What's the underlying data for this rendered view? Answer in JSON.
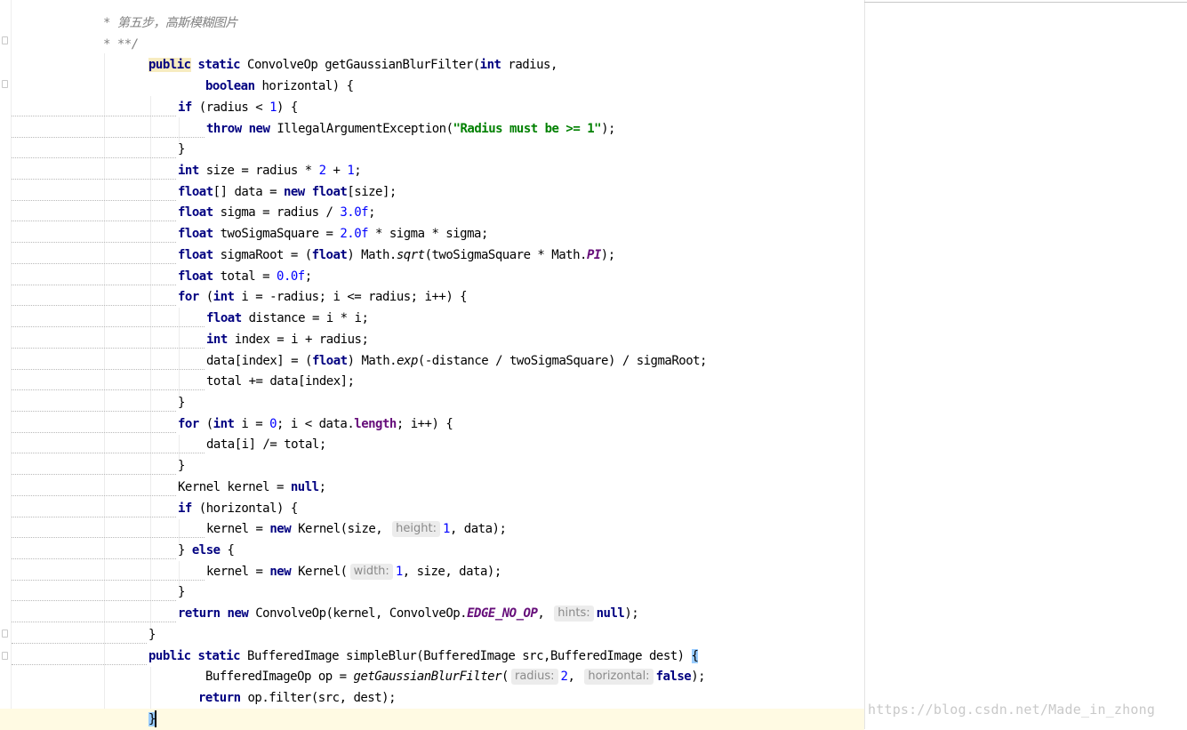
{
  "editor": {
    "lines": [
      {
        "indent": 116,
        "tokens": [
          {
            "t": "* ",
            "c": "doc"
          },
          {
            "t": "第五步，高斯模糊图片",
            "c": "doc"
          }
        ]
      },
      {
        "indent": 116,
        "tokens": [
          {
            "t": "* **/",
            "c": "doc"
          }
        ]
      },
      {
        "indent": 167,
        "tokens": [
          {
            "t": "public",
            "c": "kw hl-word"
          },
          {
            "t": " "
          },
          {
            "t": "static",
            "c": "kw"
          },
          {
            "t": " ConvolveOp getGaussianBlurFilter("
          },
          {
            "t": "int",
            "c": "kw"
          },
          {
            "t": " radius,"
          }
        ]
      },
      {
        "indent": 231,
        "tokens": [
          {
            "t": "boolean",
            "c": "kw"
          },
          {
            "t": " horizontal) {"
          }
        ]
      },
      {
        "indent": 200,
        "tokens": [
          {
            "t": "if",
            "c": "kw"
          },
          {
            "t": " (radius < "
          },
          {
            "t": "1",
            "c": "num"
          },
          {
            "t": ") {"
          }
        ]
      },
      {
        "indent": 232,
        "tokens": [
          {
            "t": "throw",
            "c": "kw"
          },
          {
            "t": " "
          },
          {
            "t": "new",
            "c": "kw"
          },
          {
            "t": " IllegalArgumentException("
          },
          {
            "t": "\"Radius must be >= 1\"",
            "c": "str"
          },
          {
            "t": ");"
          }
        ]
      },
      {
        "indent": 200,
        "tokens": [
          {
            "t": "}"
          }
        ]
      },
      {
        "indent": 200,
        "tokens": [
          {
            "t": "int",
            "c": "kw"
          },
          {
            "t": " size = radius * "
          },
          {
            "t": "2",
            "c": "num"
          },
          {
            "t": " + "
          },
          {
            "t": "1",
            "c": "num"
          },
          {
            "t": ";"
          }
        ]
      },
      {
        "indent": 200,
        "tokens": [
          {
            "t": "float",
            "c": "kw"
          },
          {
            "t": "[] data = "
          },
          {
            "t": "new",
            "c": "kw"
          },
          {
            "t": " "
          },
          {
            "t": "float",
            "c": "kw"
          },
          {
            "t": "[size];"
          }
        ]
      },
      {
        "indent": 200,
        "tokens": [
          {
            "t": "float",
            "c": "kw"
          },
          {
            "t": " sigma = radius / "
          },
          {
            "t": "3.0f",
            "c": "num"
          },
          {
            "t": ";"
          }
        ]
      },
      {
        "indent": 200,
        "tokens": [
          {
            "t": "float",
            "c": "kw"
          },
          {
            "t": " twoSigmaSquare = "
          },
          {
            "t": "2.0f",
            "c": "num"
          },
          {
            "t": " * sigma * sigma;"
          }
        ]
      },
      {
        "indent": 200,
        "tokens": [
          {
            "t": "float",
            "c": "kw"
          },
          {
            "t": " sigmaRoot = ("
          },
          {
            "t": "float",
            "c": "kw"
          },
          {
            "t": ") Math."
          },
          {
            "t": "sqrt",
            "c": "it"
          },
          {
            "t": "(twoSigmaSquare * Math."
          },
          {
            "t": "PI",
            "c": "sf"
          },
          {
            "t": ");"
          }
        ]
      },
      {
        "indent": 200,
        "tokens": [
          {
            "t": "float",
            "c": "kw"
          },
          {
            "t": " total = "
          },
          {
            "t": "0.0f",
            "c": "num"
          },
          {
            "t": ";"
          }
        ]
      },
      {
        "indent": 200,
        "tokens": [
          {
            "t": "for",
            "c": "kw"
          },
          {
            "t": " ("
          },
          {
            "t": "int",
            "c": "kw"
          },
          {
            "t": " i = -radius; i <= radius; i++) {"
          }
        ]
      },
      {
        "indent": 232,
        "tokens": [
          {
            "t": "float",
            "c": "kw"
          },
          {
            "t": " distance = i * i;"
          }
        ]
      },
      {
        "indent": 232,
        "tokens": [
          {
            "t": "int",
            "c": "kw"
          },
          {
            "t": " index = i + radius;"
          }
        ]
      },
      {
        "indent": 232,
        "tokens": [
          {
            "t": "data[index] = ("
          },
          {
            "t": "float",
            "c": "kw"
          },
          {
            "t": ") Math."
          },
          {
            "t": "exp",
            "c": "it"
          },
          {
            "t": "(-distance / twoSigmaSquare) / sigmaRoot;"
          }
        ]
      },
      {
        "indent": 232,
        "tokens": [
          {
            "t": "total += data[index];"
          }
        ]
      },
      {
        "indent": 200,
        "tokens": [
          {
            "t": "}"
          }
        ]
      },
      {
        "indent": 200,
        "tokens": [
          {
            "t": "for",
            "c": "kw"
          },
          {
            "t": " ("
          },
          {
            "t": "int",
            "c": "kw"
          },
          {
            "t": " i = "
          },
          {
            "t": "0",
            "c": "num"
          },
          {
            "t": "; i < data."
          },
          {
            "t": "length",
            "c": "fld"
          },
          {
            "t": "; i++) {"
          }
        ]
      },
      {
        "indent": 232,
        "tokens": [
          {
            "t": "data[i] /= total;"
          }
        ]
      },
      {
        "indent": 200,
        "tokens": [
          {
            "t": "}"
          }
        ]
      },
      {
        "indent": 200,
        "tokens": [
          {
            "t": "Kernel kernel = "
          },
          {
            "t": "null",
            "c": "kw"
          },
          {
            "t": ";"
          }
        ]
      },
      {
        "indent": 200,
        "tokens": [
          {
            "t": "if",
            "c": "kw"
          },
          {
            "t": " (horizontal) {"
          }
        ]
      },
      {
        "indent": 232,
        "tokens": [
          {
            "t": "kernel = "
          },
          {
            "t": "new",
            "c": "kw"
          },
          {
            "t": " Kernel(size, "
          },
          {
            "t": "height:",
            "c": "hint"
          },
          {
            "t": "1",
            "c": "num"
          },
          {
            "t": ", data);"
          }
        ]
      },
      {
        "indent": 200,
        "tokens": [
          {
            "t": "} "
          },
          {
            "t": "else",
            "c": "kw"
          },
          {
            "t": " {"
          }
        ]
      },
      {
        "indent": 232,
        "tokens": [
          {
            "t": "kernel = "
          },
          {
            "t": "new",
            "c": "kw"
          },
          {
            "t": " Kernel("
          },
          {
            "t": "width:",
            "c": "hint"
          },
          {
            "t": "1",
            "c": "num"
          },
          {
            "t": ", size, data);"
          }
        ]
      },
      {
        "indent": 200,
        "tokens": [
          {
            "t": "}"
          }
        ]
      },
      {
        "indent": 200,
        "tokens": [
          {
            "t": "return",
            "c": "kw"
          },
          {
            "t": " "
          },
          {
            "t": "new",
            "c": "kw"
          },
          {
            "t": " ConvolveOp(kernel, ConvolveOp."
          },
          {
            "t": "EDGE_NO_OP",
            "c": "sf"
          },
          {
            "t": ", "
          },
          {
            "t": "hints:",
            "c": "hint"
          },
          {
            "t": "null",
            "c": "kw"
          },
          {
            "t": ");"
          }
        ]
      },
      {
        "indent": 167,
        "tokens": [
          {
            "t": "}"
          }
        ]
      },
      {
        "indent": 167,
        "tokens": [
          {
            "t": "public",
            "c": "kw"
          },
          {
            "t": " "
          },
          {
            "t": "static",
            "c": "kw"
          },
          {
            "t": " BufferedImage simpleBlur(BufferedImage src,BufferedImage dest) "
          },
          {
            "t": "{",
            "c": "brace-match"
          }
        ]
      },
      {
        "indent": 231,
        "tokens": [
          {
            "t": "BufferedImageOp op = "
          },
          {
            "t": "getGaussianBlurFilter",
            "c": "it"
          },
          {
            "t": "("
          },
          {
            "t": "radius:",
            "c": "hint"
          },
          {
            "t": "2",
            "c": "num"
          },
          {
            "t": ", "
          },
          {
            "t": "horizontal:",
            "c": "hint"
          },
          {
            "t": "false",
            "c": "kw"
          },
          {
            "t": ");"
          }
        ]
      },
      {
        "indent": 223,
        "tokens": [
          {
            "t": "return",
            "c": "kw"
          },
          {
            "t": " op.filter(src, dest);"
          }
        ]
      },
      {
        "indent": 167,
        "tokens": [
          {
            "t": "}",
            "c": "brace-match"
          }
        ],
        "current": true
      }
    ]
  },
  "watermark": "https://blog.csdn.net/Made_in_zhong"
}
